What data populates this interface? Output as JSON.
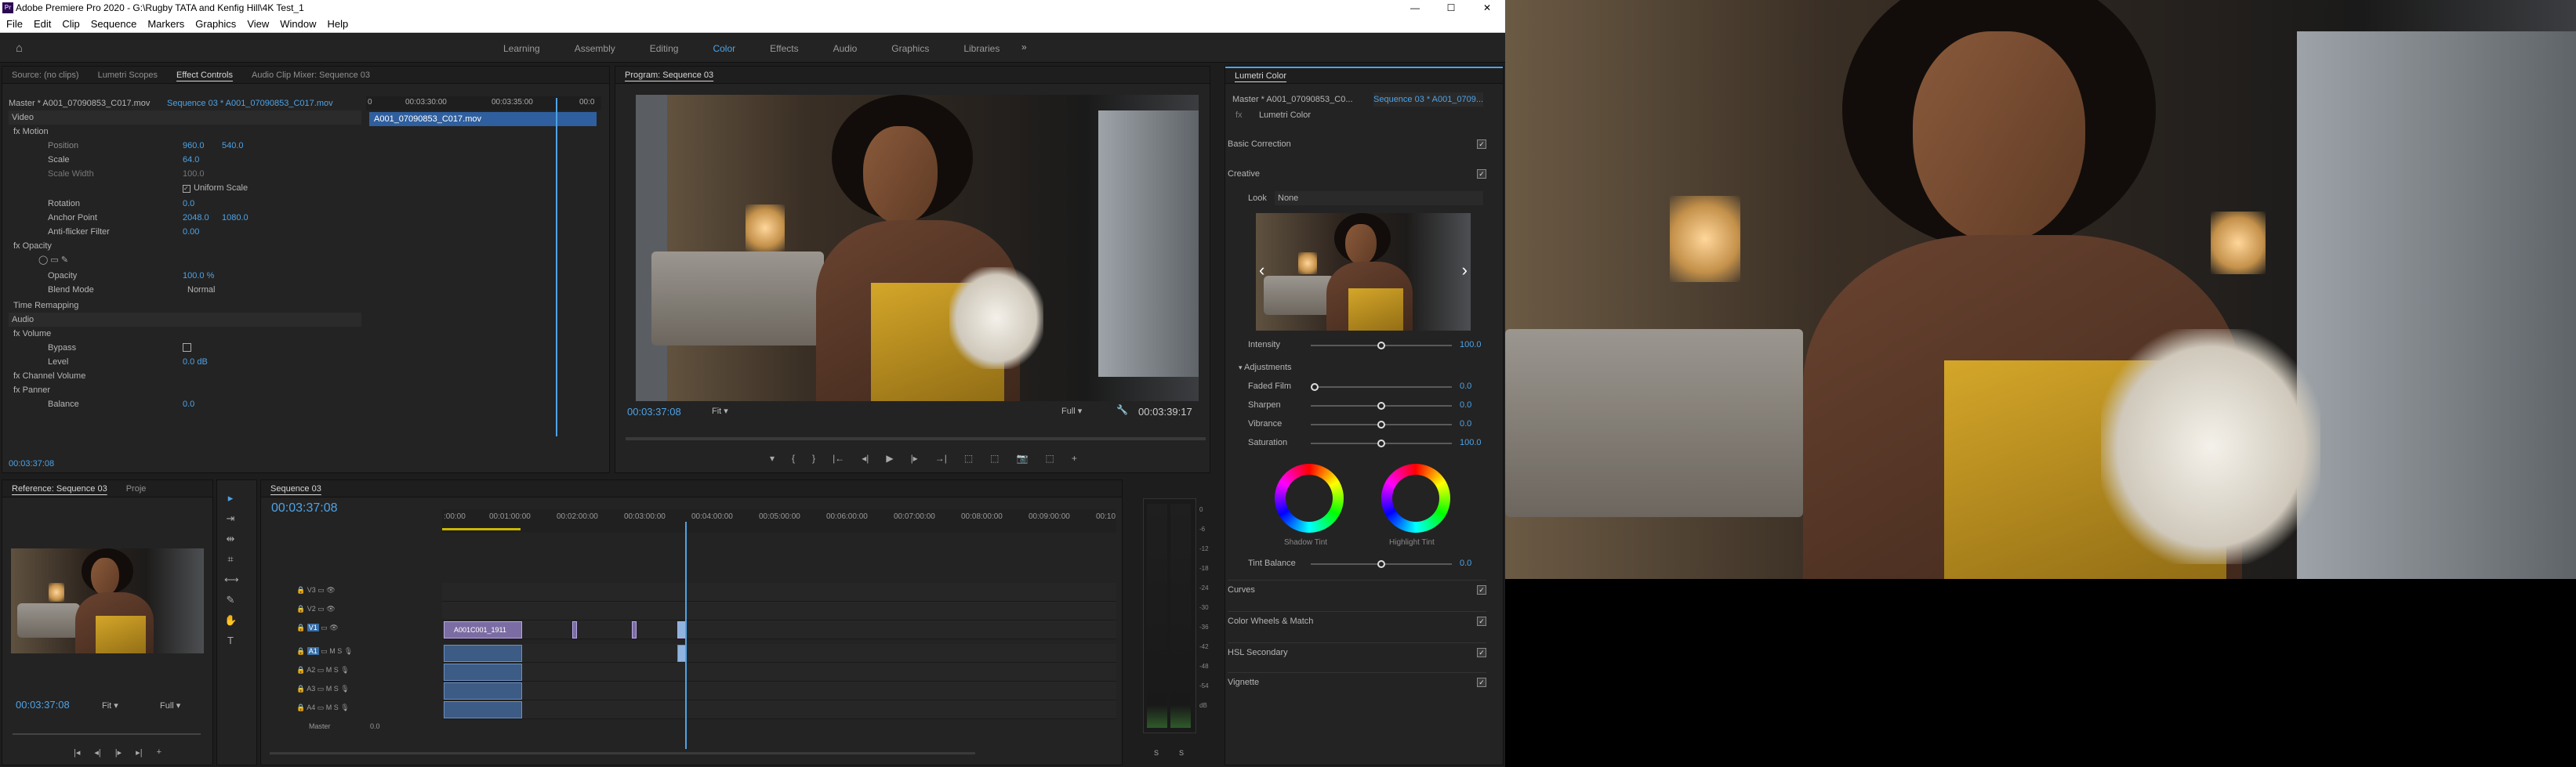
{
  "window": {
    "title": "Adobe Premiere Pro 2020 - G:\\Rugby TATA and Kenfig Hill\\4K Test_1",
    "logo": "Pr",
    "minimize": "—",
    "maximize": "☐",
    "close": "✕"
  },
  "menu": [
    "File",
    "Edit",
    "Clip",
    "Sequence",
    "Markers",
    "Graphics",
    "View",
    "Window",
    "Help"
  ],
  "workspaces": {
    "items": [
      "Learning",
      "Assembly",
      "Editing",
      "Color",
      "Effects",
      "Audio",
      "Graphics",
      "Libraries"
    ],
    "active": "Color",
    "more": "»"
  },
  "source_panel": {
    "tabs": [
      "Source: (no clips)",
      "Lumetri Scopes",
      "Effect Controls",
      "Audio Clip Mixer: Sequence 03"
    ],
    "active_tab": "Effect Controls",
    "master_label": "Master * A001_07090853_C017.mov",
    "seq_label": "Sequence 03 * A001_07090853_C017.mov",
    "ruler": [
      "0",
      "00:03:30:00",
      "00:03:35:00",
      "00:0"
    ],
    "clip_name": "A001_07090853_C017.mov",
    "timecode": "00:03:37:08",
    "rows": [
      {
        "label": "Video",
        "value": "",
        "value2": ""
      },
      {
        "label": "fx  Motion",
        "value": "",
        "value2": ""
      },
      {
        "label": "Position",
        "value": "960.0",
        "value2": "540.0"
      },
      {
        "label": "Scale",
        "value": "64.0",
        "value2": ""
      },
      {
        "label": "Scale Width",
        "value": "100.0",
        "value2": ""
      },
      {
        "label": "",
        "value": "Uniform Scale",
        "value2": ""
      },
      {
        "label": "Rotation",
        "value": "0.0",
        "value2": ""
      },
      {
        "label": "Anchor Point",
        "value": "2048.0",
        "value2": "1080.0"
      },
      {
        "label": "Anti-flicker Filter",
        "value": "0.00",
        "value2": ""
      },
      {
        "label": "fx  Opacity",
        "value": "",
        "value2": ""
      },
      {
        "label": "Opacity",
        "value": "100.0 %",
        "value2": ""
      },
      {
        "label": "Blend Mode",
        "value": "Normal",
        "value2": ""
      },
      {
        "label": "Time Remapping",
        "value": "",
        "value2": ""
      },
      {
        "label": "Audio",
        "value": "",
        "value2": ""
      },
      {
        "label": "fx  Volume",
        "value": "",
        "value2": ""
      },
      {
        "label": "Bypass",
        "value": "",
        "value2": ""
      },
      {
        "label": "Level",
        "value": "0.0 dB",
        "value2": ""
      },
      {
        "label": "fx  Channel Volume",
        "value": "",
        "value2": ""
      },
      {
        "label": "fx  Panner",
        "value": "",
        "value2": ""
      },
      {
        "label": "Balance",
        "value": "0.0",
        "value2": ""
      }
    ]
  },
  "program": {
    "tab": "Program: Sequence 03",
    "timecode_left": "00:03:37:08",
    "fit": "Fit",
    "full": "Full",
    "timecode_right": "00:03:39:17",
    "transport": [
      "▾",
      "{",
      "}",
      "|←",
      "◂|",
      "▶",
      "|▸",
      "→|",
      "⬚",
      "⬚",
      "📷",
      "⬚",
      "+"
    ]
  },
  "lumetri": {
    "tab": "Lumetri Color",
    "master": "Master * A001_07090853_C0...",
    "seq": "Sequence 03 * A001_0709...",
    "fx": "fx",
    "effect": "Lumetri Color",
    "basic": "Basic Correction",
    "creative": "Creative",
    "look_label": "Look",
    "look_value": "None",
    "intensity_label": "Intensity",
    "intensity_value": "100.0",
    "adjustments": "Adjustments",
    "sliders": [
      {
        "label": "Faded Film",
        "value": "0.0",
        "level": 0
      },
      {
        "label": "Sharpen",
        "value": "0.0",
        "level": 0.5
      },
      {
        "label": "Vibrance",
        "value": "0.0",
        "level": 0.5
      },
      {
        "label": "Saturation",
        "value": "100.0",
        "level": 0.5
      }
    ],
    "shadow_tint": "Shadow Tint",
    "highlight_tint": "Highlight Tint",
    "tint_balance_label": "Tint Balance",
    "tint_balance_value": "0.0",
    "sections": [
      "Curves",
      "Color Wheels & Match",
      "HSL Secondary",
      "Vignette"
    ]
  },
  "reference": {
    "tab": "Reference: Sequence 03",
    "tab2": "Proje",
    "timecode": "00:03:37:08",
    "fit": "Fit",
    "full": "Full"
  },
  "timeline": {
    "tab": "Sequence 03",
    "timecode": "00:03:37:08",
    "ruler": [
      ":00:00",
      "00:01:00:00",
      "00:02:00:00",
      "00:03:00:00",
      "00:04:00:00",
      "00:05:00:00",
      "00:06:00:00",
      "00:07:00:00",
      "00:08:00:00",
      "00:09:00:00",
      "00:10"
    ],
    "video_tracks": [
      "V3",
      "V2",
      "V1"
    ],
    "audio_tracks": [
      "A1",
      "A2",
      "A3",
      "A4"
    ],
    "clip_name": "A001C001_1911",
    "master_label": "Master",
    "master_value": "0.0"
  },
  "vu_labels": [
    "0",
    "-6",
    "-12",
    "-18",
    "-24",
    "-30",
    "-36",
    "-42",
    "-48",
    "-54",
    "dB"
  ],
  "vu_solo": [
    "S",
    "S"
  ]
}
